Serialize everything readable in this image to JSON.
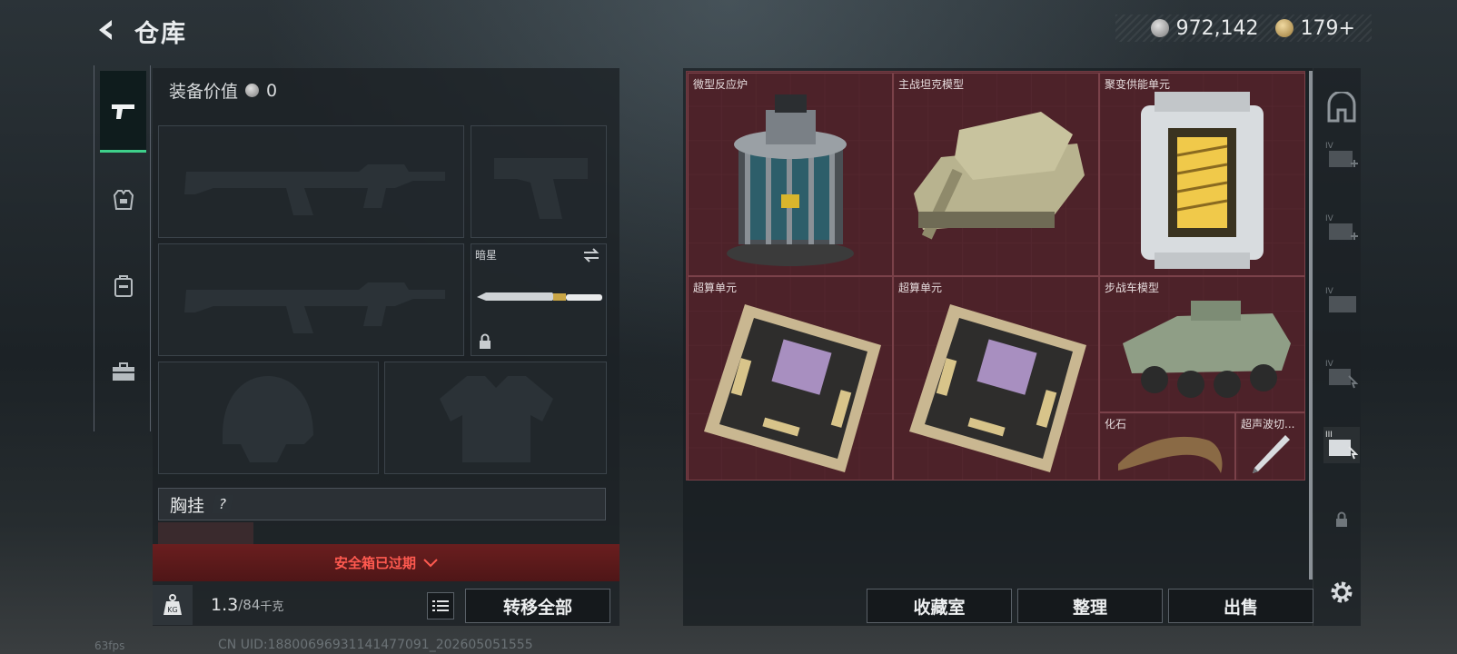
{
  "header": {
    "title": "仓库",
    "back_icon": "back-arrow-icon"
  },
  "currency": {
    "silver_value": "972,142",
    "gold_value": "179+"
  },
  "left_tabs": [
    {
      "name": "weapons",
      "icon": "pistol-icon",
      "active": true
    },
    {
      "name": "armor",
      "icon": "armor-vest-icon",
      "active": false
    },
    {
      "name": "backpack",
      "icon": "backpack-icon",
      "active": false
    },
    {
      "name": "toolbox",
      "icon": "toolbox-icon",
      "active": false
    }
  ],
  "equipment": {
    "value_label": "装备价值",
    "value": "0",
    "knife_label": "暗星",
    "chest_rig_label": "胸挂",
    "chest_help": "?"
  },
  "safe_box": {
    "status": "安全箱已过期"
  },
  "weight": {
    "current": "1.3",
    "max": "/84",
    "unit": "千克",
    "icon": "kg-weight-icon"
  },
  "buttons": {
    "transfer_all": "转移全部",
    "collection": "收藏室",
    "organize": "整理",
    "sell": "出售"
  },
  "items": [
    {
      "name": "微型反应炉"
    },
    {
      "name": "主战坦克模型"
    },
    {
      "name": "聚变供能单元"
    },
    {
      "name": "超算单元"
    },
    {
      "name": "超算单元"
    },
    {
      "name": "步战车模型"
    },
    {
      "name": "化石"
    },
    {
      "name": "超声波切..."
    }
  ],
  "colors": {
    "accent_green": "#3ed08a",
    "grid_red": "#4c2228",
    "warning_red": "#ff5a50"
  },
  "footer": {
    "uid": "CN UID:18800696931141477091_202605051555",
    "fps": "63fps"
  }
}
